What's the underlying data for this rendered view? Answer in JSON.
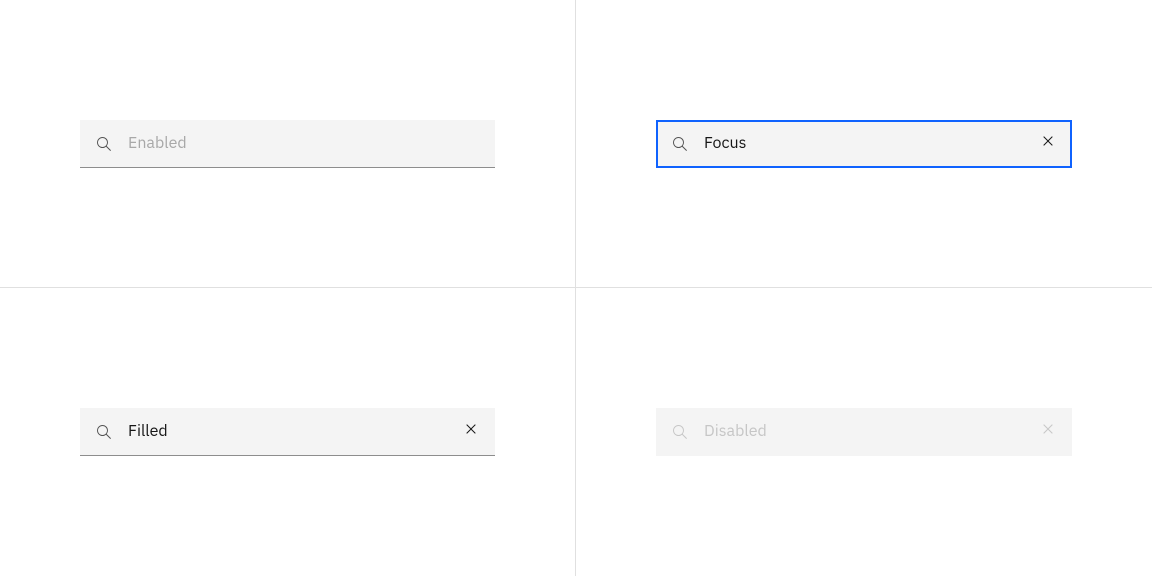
{
  "states": {
    "enabled": {
      "placeholder": "Enabled",
      "hasClose": false,
      "isFocus": false,
      "isDisabled": false,
      "isPlaceholder": true
    },
    "focus": {
      "value": "Focus",
      "hasClose": true,
      "isFocus": true,
      "isDisabled": false,
      "isPlaceholder": false
    },
    "filled": {
      "value": "Filled",
      "hasClose": true,
      "isFocus": false,
      "isDisabled": false,
      "isPlaceholder": false
    },
    "disabled": {
      "placeholder": "Disabled",
      "hasClose": true,
      "isFocus": false,
      "isDisabled": true,
      "isPlaceholder": true
    }
  }
}
